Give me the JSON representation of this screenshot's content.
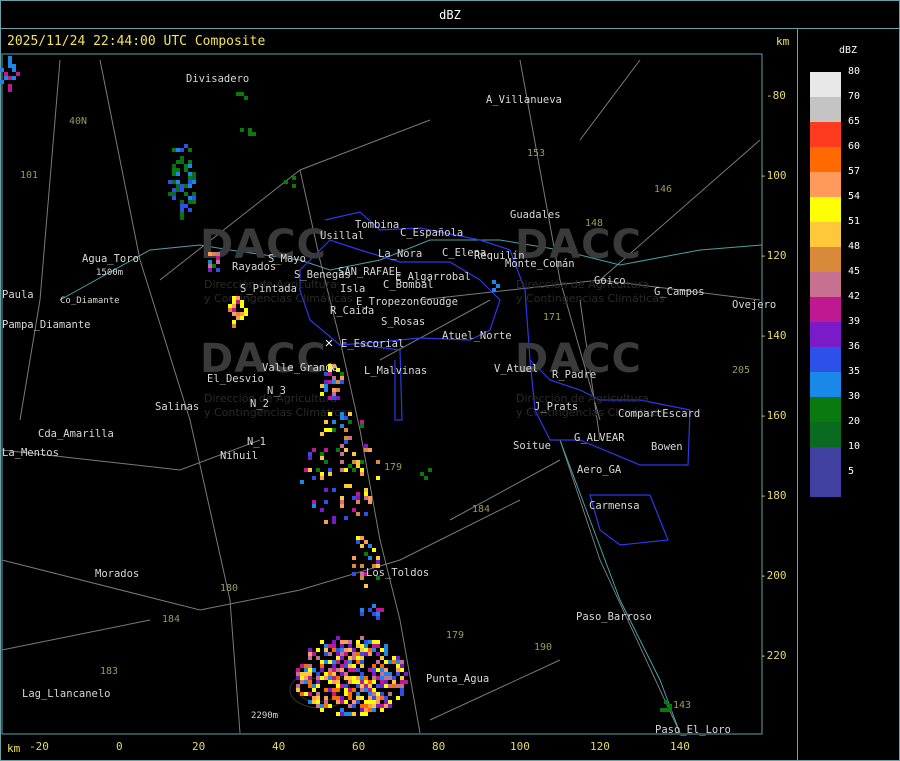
{
  "window": {
    "title": "dBZ"
  },
  "map": {
    "header": "2025/11/24 22:44:00 UTC Composite",
    "km_label_top": "km",
    "km_label_bottom": "km",
    "x_ticks": [
      "-20",
      "0",
      "20",
      "40",
      "60",
      "80",
      "100",
      "120",
      "140"
    ],
    "y_ticks": [
      "-80",
      "-100",
      "-120",
      "-140",
      "-160",
      "-180",
      "-200",
      "-220"
    ],
    "watermark": {
      "text": "DACC",
      "subtitle_1": "Dirección de Agricultura",
      "subtitle_2": "y Contingencias Climáticas"
    },
    "places": [
      "Divisadero",
      "A_Villanueva",
      "40N",
      "101",
      "153",
      "146",
      "Guadales",
      "148",
      "Tombina",
      "Usillal",
      "C_Española",
      "La_Nora",
      "C_Elena",
      "Requilín",
      "Monte_Comán",
      "Agua_Toro",
      "Rayados",
      "S_Mayo",
      "S_Benegas",
      "SAN_RAFAEL",
      "E_Algarrobal",
      "C_Bombal",
      "Goudge",
      "Goico",
      "G_Campos",
      "Ovejero",
      "Paula",
      "Pampa_Diamante",
      "S_Pintada",
      "Isla",
      "E_Tropezon",
      "R_Caida",
      "S_Rosas",
      "Atuel_Norte",
      "171",
      "E_Escorial",
      "Valle_Grande",
      "L_Malvinas",
      "V_Atuel",
      "R_Padre",
      "El_Desvio",
      "N_3",
      "N_2",
      "Salinas",
      "J_Prats",
      "CompartEscard",
      "N_1",
      "Nihuil",
      "Cda_Amarilla",
      "Soitue",
      "G_ALVEAR",
      "Bowen",
      "Aero_GA",
      "Carmensa",
      "La_Mentos",
      "179",
      "184",
      "Morados",
      "180",
      "Los_Toldos",
      "Paso_Barroso",
      "179",
      "190",
      "184",
      "183",
      "Lag_Llancanelo",
      "Punta_Agua",
      "2290m",
      "143",
      "Paso_El_Loro",
      "205",
      "1500m",
      "Co_Diamante"
    ]
  },
  "legend": {
    "title": "dBZ",
    "items": [
      {
        "value": "80",
        "color": "#e8e8e8"
      },
      {
        "value": "70",
        "color": "#c4c4c4"
      },
      {
        "value": "65",
        "color": "#ff3a1e"
      },
      {
        "value": "60",
        "color": "#ff6a00"
      },
      {
        "value": "57",
        "color": "#ff9a5a"
      },
      {
        "value": "54",
        "color": "#ffff00"
      },
      {
        "value": "51",
        "color": "#ffc83a"
      },
      {
        "value": "48",
        "color": "#d88a3a"
      },
      {
        "value": "45",
        "color": "#c87090"
      },
      {
        "value": "42",
        "color": "#c01890"
      },
      {
        "value": "39",
        "color": "#7a1ac8"
      },
      {
        "value": "36",
        "color": "#2c50e8"
      },
      {
        "value": "35",
        "color": "#1a88e8"
      },
      {
        "value": "30",
        "color": "#0a7a10"
      },
      {
        "value": "20",
        "color": "#0a6a20"
      },
      {
        "value": "10",
        "color": "#4040a0"
      },
      {
        "value": "5",
        "color": "#4040a0"
      }
    ]
  }
}
